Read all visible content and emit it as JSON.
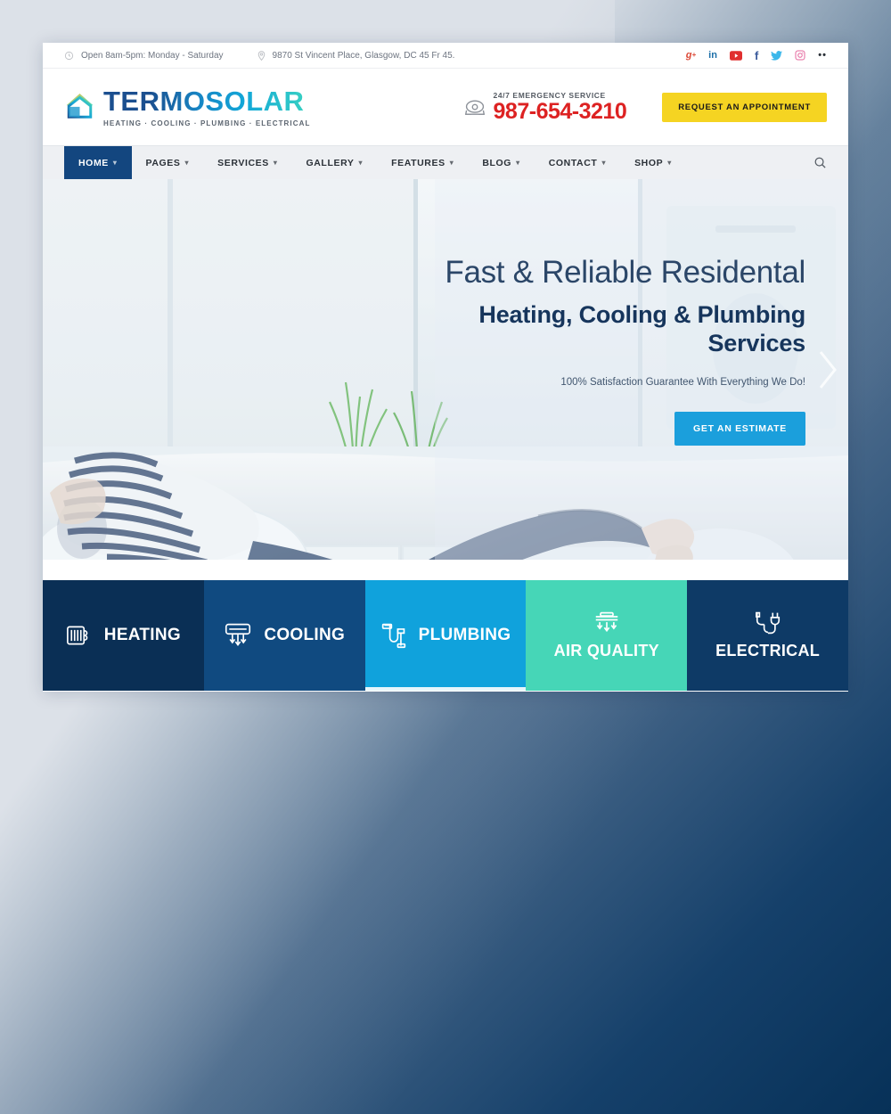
{
  "topbar": {
    "hours_icon": "clock-icon",
    "hours": "Open 8am-5pm: Monday - Saturday",
    "address_icon": "location-pin-icon",
    "address": "9870 St Vincent Place, Glasgow, DC 45 Fr 45.",
    "social": [
      {
        "name": "googleplus-icon",
        "glyph": "g+",
        "color": "#dc4a38"
      },
      {
        "name": "linkedin-icon",
        "glyph": "in",
        "color": "#1c6fa8"
      },
      {
        "name": "youtube-icon",
        "glyph": "▶",
        "color": "#e02f2f"
      },
      {
        "name": "facebook-icon",
        "glyph": "f",
        "color": "#3a5a9b"
      },
      {
        "name": "twitter-icon",
        "glyph": "✈",
        "color": "#3bb7ea"
      },
      {
        "name": "instagram-icon",
        "glyph": "◎",
        "color": "#e4649b"
      },
      {
        "name": "more-icon",
        "glyph": "••",
        "color": "#2b3138"
      }
    ]
  },
  "header": {
    "logo_name": "TERMOSOLAR",
    "logo_tagline": "HEATING  ·  COOLING  ·  PLUMBING  ·  ELECTRICAL",
    "phone_label": "24/7 EMERGENCY SERVICE",
    "phone_number": "987-654-3210",
    "phone_color": "#dd2222",
    "appointment_button": "REQUEST AN APPOINTMENT",
    "appointment_color": "#f5d422"
  },
  "nav": {
    "items": [
      {
        "label": "HOME",
        "caret": "⌄",
        "active": true
      },
      {
        "label": "PAGES",
        "caret": "⌄",
        "active": false
      },
      {
        "label": "SERVICES",
        "caret": "⌄",
        "active": false
      },
      {
        "label": "GALLERY",
        "caret": "⌄",
        "active": false
      },
      {
        "label": "FEATURES",
        "caret": "⌄",
        "active": false
      },
      {
        "label": "BLOG",
        "caret": "⌄",
        "active": false
      },
      {
        "label": "CONTACT",
        "caret": "⌄",
        "active": false
      },
      {
        "label": "SHOP",
        "caret": "⌄",
        "active": false
      }
    ],
    "active_color": "#13467f",
    "search_icon": "search-icon"
  },
  "hero": {
    "title_light": "Fast & Reliable Residental",
    "title_bold": "Heating, Cooling & Plumbing Services",
    "subtitle": "100% Satisfaction Guarantee With Everything We Do!",
    "cta_label": "GET AN ESTIMATE",
    "cta_color": "#1b9fdc",
    "next_arrow_icon": "chevron-right-icon"
  },
  "services": [
    {
      "label": "HEATING",
      "icon": "radiator-icon",
      "color": "#0a2f55",
      "layout": "row",
      "underline": false
    },
    {
      "label": "COOLING",
      "icon": "ac-unit-icon",
      "color": "#104a80",
      "layout": "row",
      "underline": false
    },
    {
      "label": "PLUMBING",
      "icon": "pipe-icon",
      "color": "#10a2dc",
      "layout": "row",
      "underline": true
    },
    {
      "label": "AIR QUALITY",
      "icon": "air-vent-icon",
      "color": "#46d6b7",
      "layout": "col",
      "underline": false
    },
    {
      "label": "ELECTRICAL",
      "icon": "plug-icon",
      "color": "#0e3a66",
      "layout": "col",
      "underline": false
    }
  ]
}
